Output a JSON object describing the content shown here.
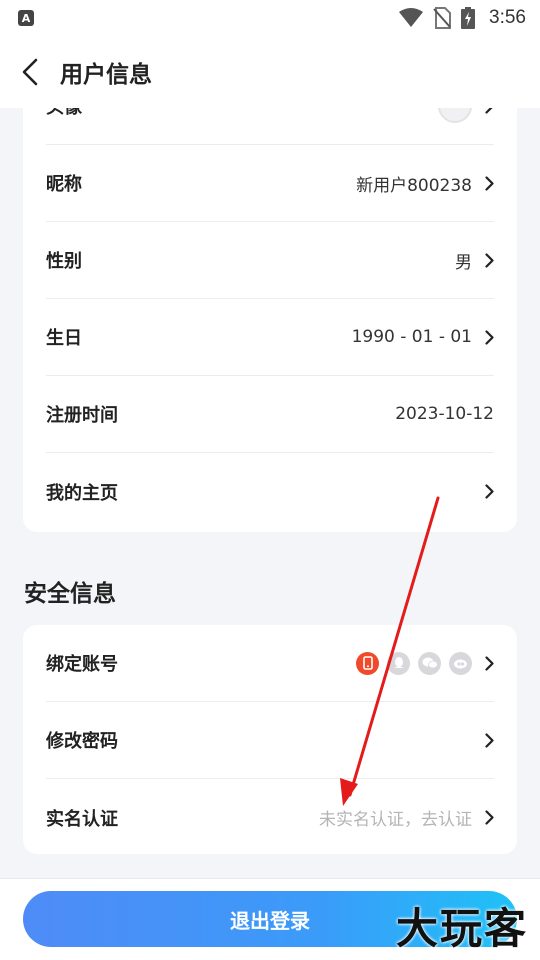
{
  "status_bar": {
    "app_icon_letter": "A",
    "time": "3:56"
  },
  "header": {
    "title": "用户信息"
  },
  "profile": {
    "rows": [
      {
        "label": "头像",
        "value": ""
      },
      {
        "label": "昵称",
        "value": "新用户800238"
      },
      {
        "label": "性别",
        "value": "男"
      },
      {
        "label": "生日",
        "value": "1990 - 01 - 01"
      },
      {
        "label": "注册时间",
        "value": "2023-10-12"
      },
      {
        "label": "我的主页",
        "value": ""
      }
    ]
  },
  "security": {
    "title": "安全信息",
    "rows": [
      {
        "label": "绑定账号",
        "value": ""
      },
      {
        "label": "修改密码",
        "value": ""
      },
      {
        "label": "实名认证",
        "value": "未实名认证，去认证"
      }
    ]
  },
  "footer": {
    "logout_label": "退出登录",
    "watermark": "大玩客"
  },
  "colors": {
    "accent_start": "#4f8bf7",
    "accent_end": "#1ec2f7",
    "phone_bind": "#f04a2a",
    "annotation_arrow": "#e31b1b"
  }
}
